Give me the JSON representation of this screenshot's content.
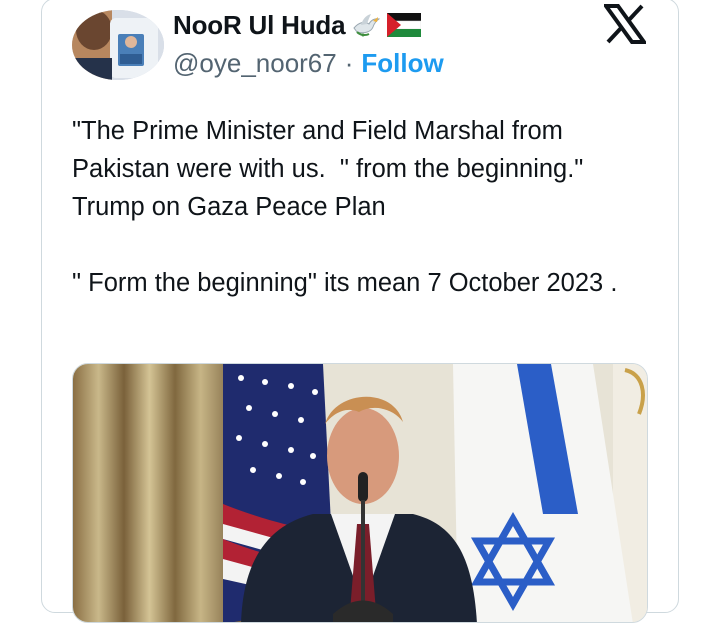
{
  "author": {
    "display_name": "NooR Ul Huda",
    "handle": "@oye_noor67",
    "separator": "·",
    "follow_label": "Follow",
    "name_emojis": [
      "dove-icon",
      "palestine-flag-icon"
    ]
  },
  "tweet": {
    "text": "\"The Prime Minister and Field Marshal from Pakistan were with us.  \" from the beginning.\"\nTrump on Gaza Peace Plan\n\n\" Form the beginning\" its mean 7 October 2023 ."
  },
  "media": {
    "type": "video-still",
    "description_icon": "press-conference-image"
  },
  "colors": {
    "text": "#0f1419",
    "secondary": "#536471",
    "accent": "#1d9bf0",
    "border": "#cfd9de"
  }
}
